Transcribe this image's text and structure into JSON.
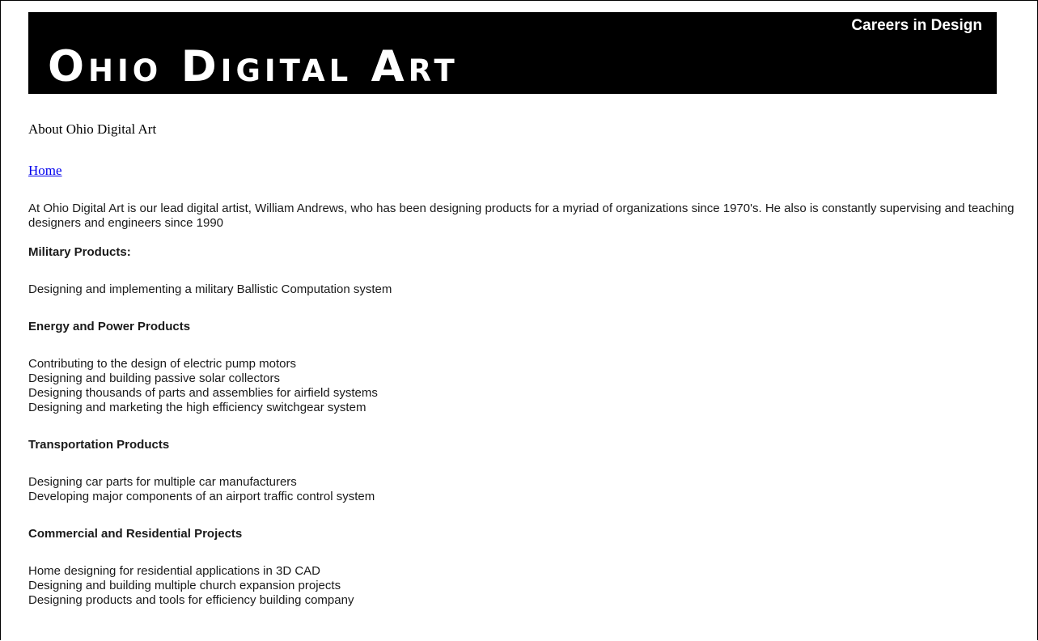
{
  "header": {
    "tagline": "Careers in Design",
    "logo_text": "Ohio Digital Art"
  },
  "page": {
    "heading": "About Ohio Digital Art",
    "home_link": "Home",
    "intro": "At Ohio Digital Art is our lead digital artist, William Andrews, who has been designing products for a myriad of organizations since 1970's. He also is constantly supervising and teaching designers and engineers since 1990"
  },
  "sections": [
    {
      "title": "Military Products:",
      "items": [
        "Designing and implementing a military Ballistic Computation system"
      ]
    },
    {
      "title": "Energy and Power Products",
      "items": [
        "Contributing to the design of electric pump motors",
        "Designing and building passive solar collectors",
        "Designing thousands of parts and assemblies for airfield systems",
        "Designing and marketing the high efficiency switchgear system"
      ]
    },
    {
      "title": "Transportation Products",
      "items": [
        "Designing car parts for multiple car manufacturers",
        "Developing major components of an airport traffic control system"
      ]
    },
    {
      "title": "Commercial and Residential Projects",
      "items": [
        "Home designing for residential applications in 3D CAD",
        "Designing and building multiple church expansion projects",
        "Designing products and tools for efficiency building company"
      ]
    }
  ],
  "colors": {
    "banner_background": "#000000",
    "banner_text": "#ffffff",
    "link": "#0000ee",
    "body_text": "#1a1a1a"
  }
}
